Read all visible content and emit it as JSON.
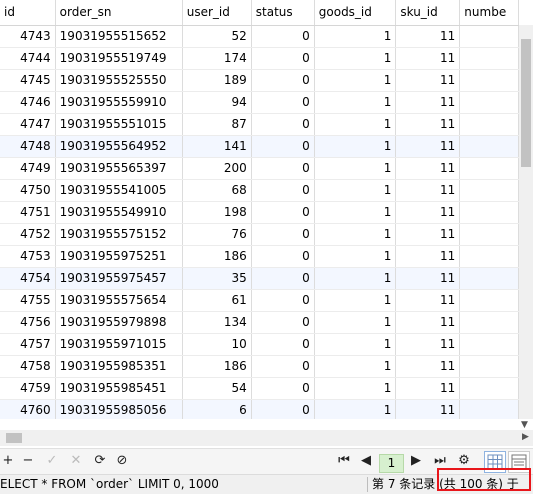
{
  "columns": [
    "id",
    "order_sn",
    "user_id",
    "status",
    "goods_id",
    "sku_id",
    "numbe"
  ],
  "rows": [
    [
      "4743",
      "19031955515652",
      "52",
      "0",
      "1",
      "11"
    ],
    [
      "4744",
      "19031955519749",
      "174",
      "0",
      "1",
      "11"
    ],
    [
      "4745",
      "19031955525550",
      "189",
      "0",
      "1",
      "11"
    ],
    [
      "4746",
      "19031955559910",
      "94",
      "0",
      "1",
      "11"
    ],
    [
      "4747",
      "19031955551015",
      "87",
      "0",
      "1",
      "11"
    ],
    [
      "4748",
      "19031955564952",
      "141",
      "0",
      "1",
      "11"
    ],
    [
      "4749",
      "19031955565397",
      "200",
      "0",
      "1",
      "11"
    ],
    [
      "4750",
      "19031955541005",
      "68",
      "0",
      "1",
      "11"
    ],
    [
      "4751",
      "19031955549910",
      "198",
      "0",
      "1",
      "11"
    ],
    [
      "4752",
      "19031955575152",
      "76",
      "0",
      "1",
      "11"
    ],
    [
      "4753",
      "19031955975251",
      "186",
      "0",
      "1",
      "11"
    ],
    [
      "4754",
      "19031955975457",
      "35",
      "0",
      "1",
      "11"
    ],
    [
      "4755",
      "19031955575654",
      "61",
      "0",
      "1",
      "11"
    ],
    [
      "4756",
      "19031955979898",
      "134",
      "0",
      "1",
      "11"
    ],
    [
      "4757",
      "19031955971015",
      "10",
      "0",
      "1",
      "11"
    ],
    [
      "4758",
      "19031955985351",
      "186",
      "0",
      "1",
      "11"
    ],
    [
      "4759",
      "19031955985451",
      "54",
      "0",
      "1",
      "11"
    ],
    [
      "4760",
      "19031955985056",
      "6",
      "0",
      "1",
      "11"
    ]
  ],
  "toolbar": {
    "add": "+",
    "remove": "−",
    "apply": "✓",
    "cancel": "✕",
    "refresh": "⟳",
    "stop": "⊘",
    "first": "⏮",
    "prev": "◀",
    "page": "1",
    "next": "▶",
    "last": "⏭",
    "settings": "⚙"
  },
  "status": {
    "sql": "ELECT * FROM `order` LIMIT 0, 1000",
    "record": "第 7 条记录 (共 100 条) 于"
  },
  "colors": {
    "alt_row": "#f3f7ff",
    "highlight": "#e8161b",
    "page_bg": "#d7f0cf"
  }
}
